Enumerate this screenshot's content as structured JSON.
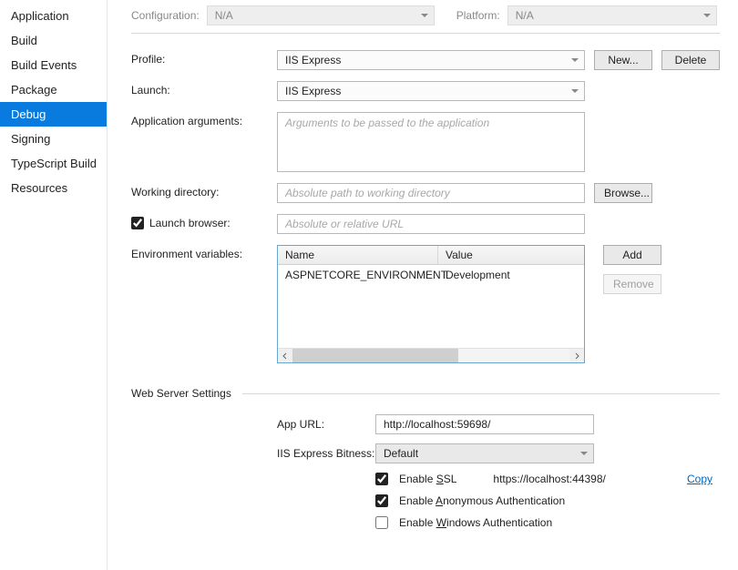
{
  "sidebar": {
    "items": [
      {
        "label": "Application"
      },
      {
        "label": "Build"
      },
      {
        "label": "Build Events"
      },
      {
        "label": "Package"
      },
      {
        "label": "Debug"
      },
      {
        "label": "Signing"
      },
      {
        "label": "TypeScript Build"
      },
      {
        "label": "Resources"
      }
    ]
  },
  "top": {
    "configLabel": "Configuration:",
    "configValue": "N/A",
    "platformLabel": "Platform:",
    "platformValue": "N/A"
  },
  "form": {
    "profile": {
      "label": "Profile:",
      "value": "IIS Express",
      "newBtn": "New...",
      "deleteBtn": "Delete"
    },
    "launch": {
      "label": "Launch:",
      "value": "IIS Express"
    },
    "appArgs": {
      "label": "Application arguments:",
      "placeholder": "Arguments to be passed to the application"
    },
    "workingDir": {
      "label": "Working directory:",
      "placeholder": "Absolute path to working directory",
      "browseBtn": "Browse..."
    },
    "launchBrowser": {
      "label": "Launch browser:",
      "placeholder": "Absolute or relative URL",
      "checked": true
    },
    "envVars": {
      "label": "Environment variables:",
      "headerName": "Name",
      "headerValue": "Value",
      "rows": [
        {
          "name": "ASPNETCORE_ENVIRONMENT",
          "value": "Development"
        }
      ],
      "addBtn": "Add",
      "removeBtn": "Remove"
    }
  },
  "webServer": {
    "sectionTitle": "Web Server Settings",
    "appUrl": {
      "label": "App URL:",
      "value": "http://localhost:59698/"
    },
    "bitness": {
      "label": "IIS Express Bitness:",
      "value": "Default"
    },
    "ssl": {
      "labelPrefix": "Enable ",
      "labelLetter": "S",
      "labelSuffix": "SL",
      "url": "https://localhost:44398/",
      "copy": "Copy",
      "checked": true
    },
    "anon": {
      "labelPrefix": "Enable ",
      "labelLetter": "A",
      "labelSuffix": "nonymous Authentication",
      "checked": true
    },
    "winAuth": {
      "labelPrefix": "Enable ",
      "labelLetter": "W",
      "labelSuffix": "indows Authentication",
      "checked": false
    }
  }
}
